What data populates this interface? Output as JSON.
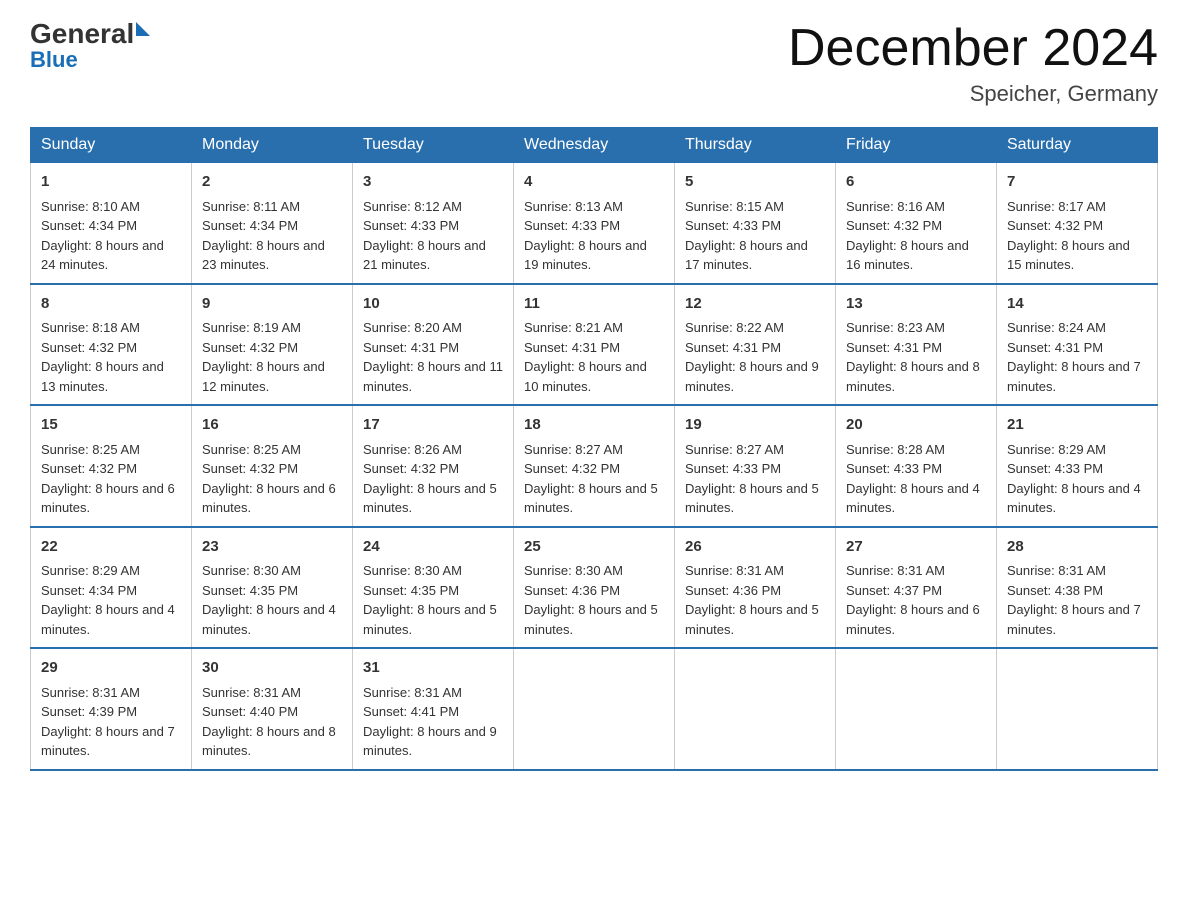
{
  "logo": {
    "general": "General",
    "blue": "Blue"
  },
  "title": "December 2024",
  "location": "Speicher, Germany",
  "days_of_week": [
    "Sunday",
    "Monday",
    "Tuesday",
    "Wednesday",
    "Thursday",
    "Friday",
    "Saturday"
  ],
  "weeks": [
    [
      {
        "day": "1",
        "sunrise": "8:10 AM",
        "sunset": "4:34 PM",
        "daylight": "8 hours and 24 minutes."
      },
      {
        "day": "2",
        "sunrise": "8:11 AM",
        "sunset": "4:34 PM",
        "daylight": "8 hours and 23 minutes."
      },
      {
        "day": "3",
        "sunrise": "8:12 AM",
        "sunset": "4:33 PM",
        "daylight": "8 hours and 21 minutes."
      },
      {
        "day": "4",
        "sunrise": "8:13 AM",
        "sunset": "4:33 PM",
        "daylight": "8 hours and 19 minutes."
      },
      {
        "day": "5",
        "sunrise": "8:15 AM",
        "sunset": "4:33 PM",
        "daylight": "8 hours and 17 minutes."
      },
      {
        "day": "6",
        "sunrise": "8:16 AM",
        "sunset": "4:32 PM",
        "daylight": "8 hours and 16 minutes."
      },
      {
        "day": "7",
        "sunrise": "8:17 AM",
        "sunset": "4:32 PM",
        "daylight": "8 hours and 15 minutes."
      }
    ],
    [
      {
        "day": "8",
        "sunrise": "8:18 AM",
        "sunset": "4:32 PM",
        "daylight": "8 hours and 13 minutes."
      },
      {
        "day": "9",
        "sunrise": "8:19 AM",
        "sunset": "4:32 PM",
        "daylight": "8 hours and 12 minutes."
      },
      {
        "day": "10",
        "sunrise": "8:20 AM",
        "sunset": "4:31 PM",
        "daylight": "8 hours and 11 minutes."
      },
      {
        "day": "11",
        "sunrise": "8:21 AM",
        "sunset": "4:31 PM",
        "daylight": "8 hours and 10 minutes."
      },
      {
        "day": "12",
        "sunrise": "8:22 AM",
        "sunset": "4:31 PM",
        "daylight": "8 hours and 9 minutes."
      },
      {
        "day": "13",
        "sunrise": "8:23 AM",
        "sunset": "4:31 PM",
        "daylight": "8 hours and 8 minutes."
      },
      {
        "day": "14",
        "sunrise": "8:24 AM",
        "sunset": "4:31 PM",
        "daylight": "8 hours and 7 minutes."
      }
    ],
    [
      {
        "day": "15",
        "sunrise": "8:25 AM",
        "sunset": "4:32 PM",
        "daylight": "8 hours and 6 minutes."
      },
      {
        "day": "16",
        "sunrise": "8:25 AM",
        "sunset": "4:32 PM",
        "daylight": "8 hours and 6 minutes."
      },
      {
        "day": "17",
        "sunrise": "8:26 AM",
        "sunset": "4:32 PM",
        "daylight": "8 hours and 5 minutes."
      },
      {
        "day": "18",
        "sunrise": "8:27 AM",
        "sunset": "4:32 PM",
        "daylight": "8 hours and 5 minutes."
      },
      {
        "day": "19",
        "sunrise": "8:27 AM",
        "sunset": "4:33 PM",
        "daylight": "8 hours and 5 minutes."
      },
      {
        "day": "20",
        "sunrise": "8:28 AM",
        "sunset": "4:33 PM",
        "daylight": "8 hours and 4 minutes."
      },
      {
        "day": "21",
        "sunrise": "8:29 AM",
        "sunset": "4:33 PM",
        "daylight": "8 hours and 4 minutes."
      }
    ],
    [
      {
        "day": "22",
        "sunrise": "8:29 AM",
        "sunset": "4:34 PM",
        "daylight": "8 hours and 4 minutes."
      },
      {
        "day": "23",
        "sunrise": "8:30 AM",
        "sunset": "4:35 PM",
        "daylight": "8 hours and 4 minutes."
      },
      {
        "day": "24",
        "sunrise": "8:30 AM",
        "sunset": "4:35 PM",
        "daylight": "8 hours and 5 minutes."
      },
      {
        "day": "25",
        "sunrise": "8:30 AM",
        "sunset": "4:36 PM",
        "daylight": "8 hours and 5 minutes."
      },
      {
        "day": "26",
        "sunrise": "8:31 AM",
        "sunset": "4:36 PM",
        "daylight": "8 hours and 5 minutes."
      },
      {
        "day": "27",
        "sunrise": "8:31 AM",
        "sunset": "4:37 PM",
        "daylight": "8 hours and 6 minutes."
      },
      {
        "day": "28",
        "sunrise": "8:31 AM",
        "sunset": "4:38 PM",
        "daylight": "8 hours and 7 minutes."
      }
    ],
    [
      {
        "day": "29",
        "sunrise": "8:31 AM",
        "sunset": "4:39 PM",
        "daylight": "8 hours and 7 minutes."
      },
      {
        "day": "30",
        "sunrise": "8:31 AM",
        "sunset": "4:40 PM",
        "daylight": "8 hours and 8 minutes."
      },
      {
        "day": "31",
        "sunrise": "8:31 AM",
        "sunset": "4:41 PM",
        "daylight": "8 hours and 9 minutes."
      },
      null,
      null,
      null,
      null
    ]
  ]
}
